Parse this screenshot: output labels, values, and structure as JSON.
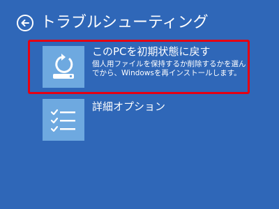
{
  "header": {
    "title": "トラブルシューティング"
  },
  "options": [
    {
      "title": "このPCを初期状態に戻す",
      "description": "個人用ファイルを保持するか削除するかを選んでから、Windowsを再インストールします。",
      "icon": "reset-pc-icon"
    },
    {
      "title": "詳細オプション",
      "icon": "checklist-icon"
    }
  ],
  "colors": {
    "background": "#2f67b8",
    "tile": "#6ea9e0",
    "highlight": "#e60012"
  }
}
